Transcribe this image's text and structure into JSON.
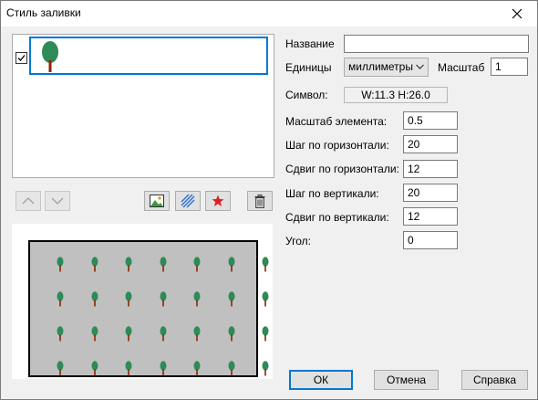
{
  "window": {
    "title": "Стиль заливки"
  },
  "list": {
    "items": [
      {
        "checked": true,
        "icon": "tree-icon"
      }
    ]
  },
  "toolbar": {
    "up_icon": "chevron-up-icon",
    "down_icon": "chevron-down-icon",
    "image_icon": "image-icon",
    "hatch_icon": "hatch-icon",
    "symbol_icon": "star-icon",
    "delete_icon": "trash-icon"
  },
  "form": {
    "name_label": "Название",
    "name_value": "",
    "units_label": "Единицы",
    "units_value": "миллиметры",
    "scale_label": "Масштаб",
    "scale_value": "1",
    "symbol_label": "Символ:",
    "symbol_value": "W:11.3  H:26.0",
    "element_scale_label": "Масштаб элемента:",
    "element_scale_value": "0.5",
    "h_step_label": "Шаг по горизонтали:",
    "h_step_value": "20",
    "h_shift_label": "Сдвиг по горизонтали:",
    "h_shift_value": "12",
    "v_step_label": "Шаг по вертикали:",
    "v_step_value": "20",
    "v_shift_label": "Сдвиг по вертикали:",
    "v_shift_value": "12",
    "angle_label": "Угол:",
    "angle_value": "0"
  },
  "buttons": {
    "ok": "ОК",
    "cancel": "Отмена",
    "help": "Справка"
  },
  "preview": {
    "rows": 4,
    "cols": 7,
    "symbol": "tree-icon"
  },
  "colors": {
    "accent": "#0078d7",
    "tree_crown": "#2e8b57",
    "tree_trunk": "#8b2500",
    "preview_bg": "#c0c0c0",
    "star": "#e0201e"
  }
}
